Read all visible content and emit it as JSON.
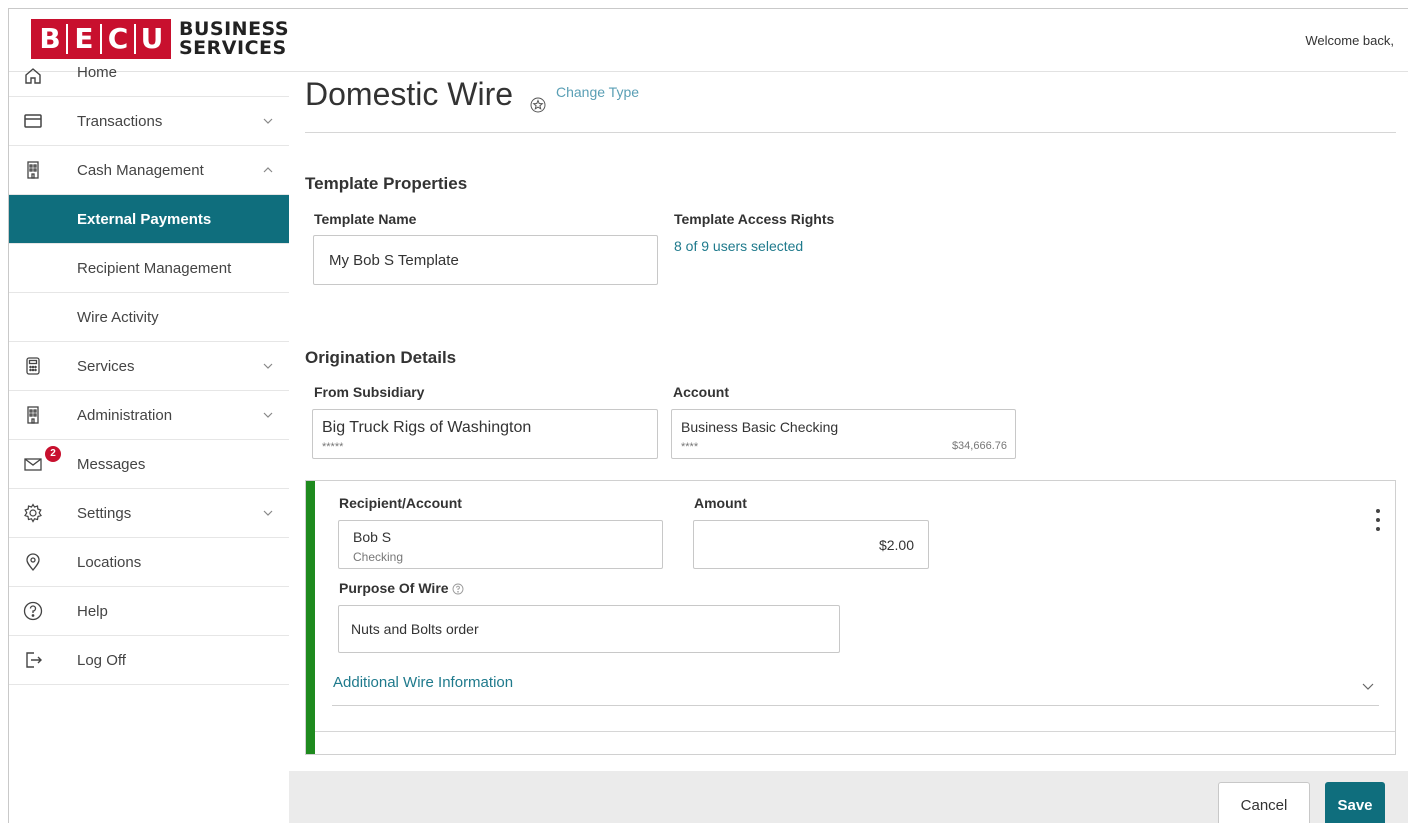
{
  "header": {
    "logo_letters": [
      "B",
      "E",
      "C",
      "U"
    ],
    "logo_line1": "BUSINESS",
    "logo_line2": "SERVICES",
    "welcome": "Welcome back,"
  },
  "sidebar": {
    "items": [
      {
        "label": "Home",
        "icon": "home-icon"
      },
      {
        "label": "Transactions",
        "icon": "card-icon"
      },
      {
        "label": "Cash Management",
        "icon": "building-icon"
      },
      {
        "label": "External Payments"
      },
      {
        "label": "Recipient Management"
      },
      {
        "label": "Wire Activity"
      },
      {
        "label": "Services",
        "icon": "calculator-icon"
      },
      {
        "label": "Administration",
        "icon": "building-icon"
      },
      {
        "label": "Messages",
        "icon": "mail-icon",
        "badge": "2"
      },
      {
        "label": "Settings",
        "icon": "gear-icon"
      },
      {
        "label": "Locations",
        "icon": "location-pin-icon"
      },
      {
        "label": "Help",
        "icon": "help-icon"
      },
      {
        "label": "Log Off",
        "icon": "log-off-icon"
      }
    ]
  },
  "main": {
    "title": "Domestic Wire",
    "change_type": "Change Type",
    "template_properties": {
      "heading": "Template Properties",
      "name_label": "Template Name",
      "name_value": "My Bob S Template",
      "access_label": "Template Access Rights",
      "access_value": "8 of 9 users selected"
    },
    "origination": {
      "heading": "Origination Details",
      "subsidiary_label": "From Subsidiary",
      "subsidiary_value": "Big Truck Rigs of Washington",
      "subsidiary_mask": "*****",
      "account_label": "Account",
      "account_value": "Business Basic Checking",
      "account_mask": "****",
      "account_balance": "$34,666.76"
    },
    "wire": {
      "recipient_label": "Recipient/Account",
      "recipient_name": "Bob S",
      "recipient_account": "Checking",
      "amount_label": "Amount",
      "amount_value": "$2.00",
      "purpose_label": "Purpose Of Wire",
      "purpose_value": "Nuts and Bolts order",
      "additional_info": "Additional Wire Information"
    },
    "actions": {
      "cancel": "Cancel",
      "save": "Save"
    }
  },
  "colors": {
    "brand_red": "#c8102e",
    "teal": "#0f6e7d",
    "green_bar": "#1e8a1e"
  }
}
